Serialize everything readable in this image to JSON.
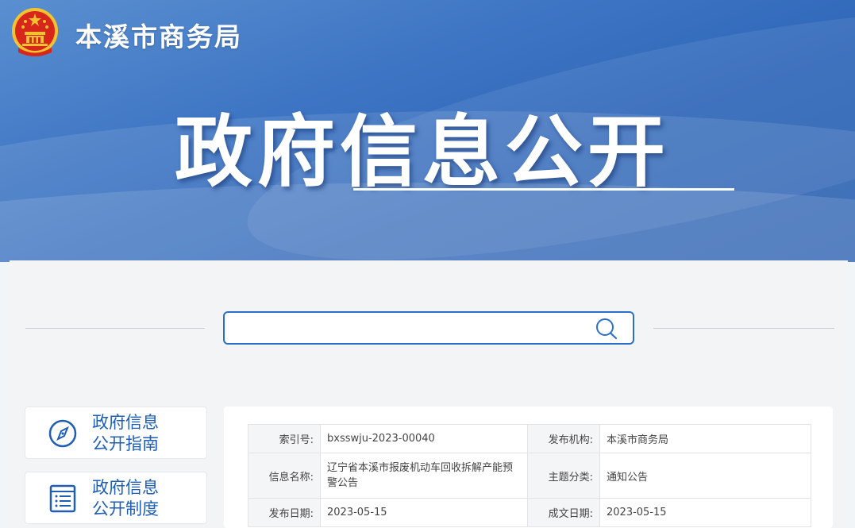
{
  "header": {
    "site_title": "本溪市商务局",
    "page_title": "政府信息公开"
  },
  "search": {
    "value": "",
    "placeholder": ""
  },
  "nav": [
    {
      "line1": "政府信息",
      "line2": "公开指南",
      "icon": "compass-icon"
    },
    {
      "line1": "政府信息",
      "line2": "公开制度",
      "icon": "document-list-icon"
    }
  ],
  "info_table": {
    "index_no_label": "索引号:",
    "index_no_value": "bxsswju-2023-00040",
    "publisher_label": "发布机构:",
    "publisher_value": "本溪市商务局",
    "name_label": "信息名称:",
    "name_value": "辽宁省本溪市报废机动车回收拆解产能预警公告",
    "topic_label": "主题分类:",
    "topic_value": "通知公告",
    "publish_date_label": "发布日期:",
    "publish_date_value": "2023-05-15",
    "created_date_label": "成文日期:",
    "created_date_value": "2023-05-15"
  },
  "colors": {
    "banner_blue": "#2e66b8",
    "accent_blue": "#2c6fc6",
    "nav_text": "#1e5fb5",
    "emblem_red": "#d8261b",
    "emblem_gold": "#f2c230"
  }
}
